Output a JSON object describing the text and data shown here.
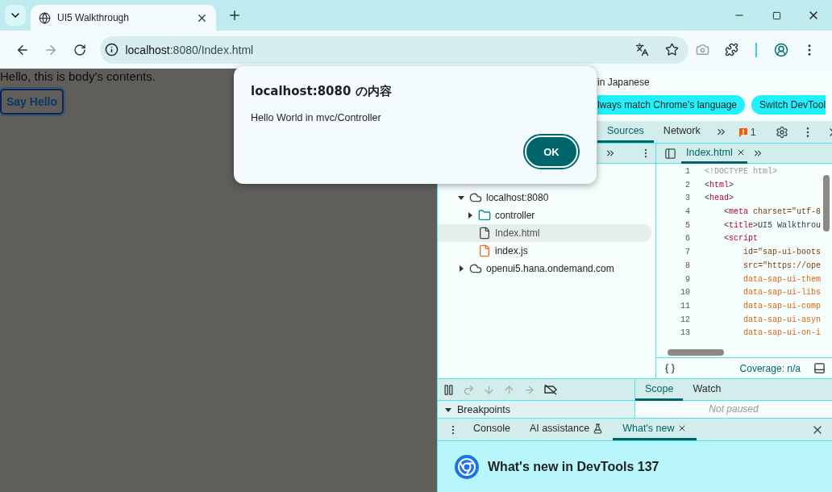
{
  "browser": {
    "tabs": [
      {
        "title": "UI5 Walkthrough",
        "selected": true
      }
    ],
    "address": {
      "host": "localhost",
      "path": ":8080/Index.html"
    }
  },
  "page": {
    "text": "Hello, this is body's contents.",
    "button": "Say Hello"
  },
  "dialog": {
    "title": "localhost:8080 の内容",
    "message": "Hello World in mvc/Controller",
    "ok": "OK"
  },
  "devtools": {
    "banner": {
      "text": "in Japanese",
      "buttons": [
        "lways match Chrome's language",
        "Switch DevTool"
      ]
    },
    "tabs": [
      {
        "label": "Sources",
        "selected": true
      },
      {
        "label": "Network",
        "selected": false
      }
    ],
    "issues": "1",
    "navigator": {
      "tree": [
        {
          "label": "localhost:8080",
          "kind": "origin",
          "expanded": true,
          "selected": false,
          "children": [
            {
              "label": "controller",
              "kind": "folder",
              "expanded": false,
              "selected": false
            },
            {
              "label": "Index.html",
              "kind": "file",
              "selected": true
            },
            {
              "label": "index.js",
              "kind": "script",
              "selected": false
            }
          ]
        },
        {
          "label": "openui5.hana.ondemand.com",
          "kind": "origin",
          "expanded": false,
          "selected": false
        }
      ]
    },
    "editor": {
      "tabs": [
        {
          "label": "Index.html",
          "selected": true
        }
      ],
      "lines": [
        {
          "number": "1",
          "tokens": [
            {
              "kind": "doctype",
              "text": "<!DOCTYPE html>"
            }
          ]
        },
        {
          "number": "2",
          "tokens": [
            {
              "kind": "punct",
              "text": "<"
            },
            {
              "kind": "tag",
              "text": "html"
            },
            {
              "kind": "punct",
              "text": ">"
            }
          ]
        },
        {
          "number": "3",
          "tokens": [
            {
              "kind": "punct",
              "text": "<"
            },
            {
              "kind": "tag",
              "text": "head"
            },
            {
              "kind": "punct",
              "text": ">"
            }
          ]
        },
        {
          "number": "4",
          "tokens": [
            {
              "kind": "punct",
              "text": "    <"
            },
            {
              "kind": "tag",
              "text": "meta"
            },
            {
              "kind": "value",
              "text": " charset=\"utf-8"
            }
          ]
        },
        {
          "number": "5",
          "tokens": [
            {
              "kind": "punct",
              "text": "    <"
            },
            {
              "kind": "tag",
              "text": "title"
            },
            {
              "kind": "punct",
              "text": ">UI5 Walkthrou"
            }
          ]
        },
        {
          "number": "6",
          "tokens": [
            {
              "kind": "punct",
              "text": "    <"
            },
            {
              "kind": "tag",
              "text": "script"
            }
          ]
        },
        {
          "number": "7",
          "tokens": [
            {
              "kind": "value",
              "text": "        id=\"sap-ui-boots"
            }
          ]
        },
        {
          "number": "8",
          "tokens": [
            {
              "kind": "value",
              "text": "        src=\"https://ope"
            }
          ]
        },
        {
          "number": "9",
          "tokens": [
            {
              "kind": "attr",
              "text": "        data-sap-ui-them"
            }
          ]
        },
        {
          "number": "10",
          "tokens": [
            {
              "kind": "attr",
              "text": "        data-sap-ui-libs"
            }
          ]
        },
        {
          "number": "11",
          "tokens": [
            {
              "kind": "attr",
              "text": "        data-sap-ui-comp"
            }
          ]
        },
        {
          "number": "12",
          "tokens": [
            {
              "kind": "attr",
              "text": "        data-sap-ui-asyn"
            }
          ]
        },
        {
          "number": "13",
          "tokens": [
            {
              "kind": "attr",
              "text": "        data-sap-ui-on-i"
            }
          ]
        }
      ],
      "coverage": "Coverage: n/a"
    },
    "debugger": {
      "sections": [
        {
          "label": "Breakpoints",
          "expanded": true
        }
      ],
      "tabs": [
        {
          "label": "Scope",
          "selected": true
        },
        {
          "label": "Watch",
          "selected": false
        }
      ],
      "status": "Not paused"
    },
    "drawer": {
      "tabs": [
        {
          "label": "Console",
          "selected": false,
          "experimental": false,
          "closable": false
        },
        {
          "label": "AI assistance",
          "selected": false,
          "experimental": true,
          "closable": false
        },
        {
          "label": "What's new",
          "selected": true,
          "experimental": false,
          "closable": true
        }
      ],
      "heading": "What's new in DevTools 137"
    }
  }
}
